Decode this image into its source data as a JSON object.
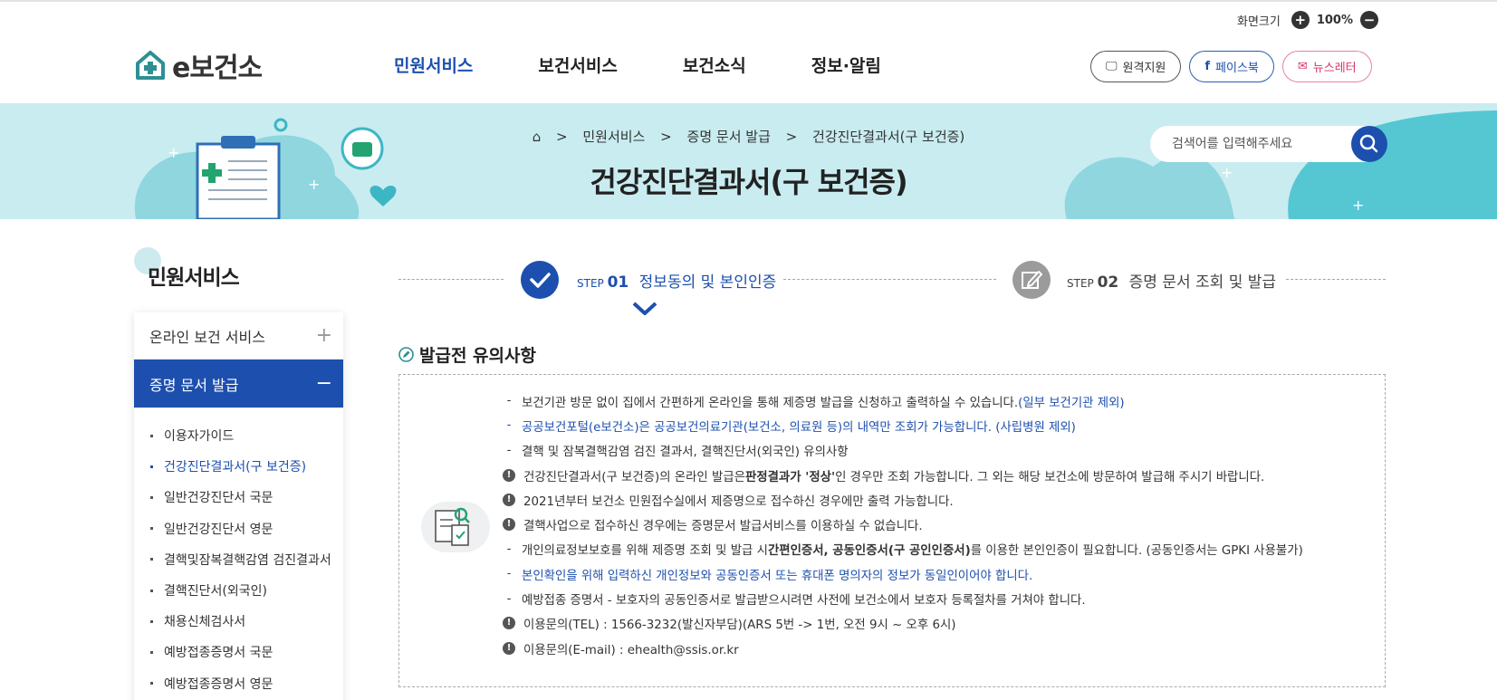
{
  "zoom": {
    "label": "화면크기",
    "value": "100%",
    "plus": "+",
    "minus": "−"
  },
  "logo": {
    "text": "e보건소"
  },
  "gnb": [
    {
      "label": "민원서비스",
      "active": true
    },
    {
      "label": "보건서비스"
    },
    {
      "label": "보건소식"
    },
    {
      "label": "정보·알림"
    }
  ],
  "header_buttons": {
    "remote": "원격지원",
    "facebook": "페이스북",
    "newsletter": "뉴스레터"
  },
  "breadcrumb": {
    "level1": "민원서비스",
    "level2": "증명 문서 발급",
    "level3": "건강진단결과서(구 보건증)",
    "sep": ">"
  },
  "page_title": "건강진단결과서(구 보건증)",
  "search": {
    "placeholder": "검색어를 입력해주세요"
  },
  "side": {
    "title": "민원서비스",
    "groups": [
      {
        "label": "온라인 보건 서비스",
        "toggle": "+"
      },
      {
        "label": "증명 문서 발급",
        "toggle": "−"
      }
    ],
    "items": [
      "이용자가이드",
      "건강진단결과서(구 보건증)",
      "일반건강진단서 국문",
      "일반건강진단서 영문",
      "결핵및잠복결핵감염 검진결과서",
      "결핵진단서(외국인)",
      "채용신체검사서",
      "예방접종증명서 국문",
      "예방접종증명서 영문"
    ]
  },
  "steps": [
    {
      "step": "STEP",
      "num": "01",
      "label": "정보동의 및 본인인증"
    },
    {
      "step": "STEP",
      "num": "02",
      "label": "증명 문서 조회 및 발급"
    }
  ],
  "notice": {
    "title": "발급전 유의사항",
    "dash": "-",
    "exc": "!",
    "line1": {
      "text": "보건기관 방문 없이 집에서 간편하게 온라인을 통해 제증명 발급을 신청하고 출력하실 수 있습니다.",
      "hl": "(일부 보건기관 제외)"
    },
    "line2": "공공보건포털(e보건소)은 공공보건의료기관(보건소, 의료원 등)의 내역만 조회가 가능합니다. (사립병원 제외)",
    "line3": "결핵 및 잠복결핵감염 검진 결과서, 결핵진단서(외국인) 유의사항",
    "line4": {
      "a": "건강진단결과서(구 보건증)의 온라인 발급은 ",
      "b": "판정결과가 '정상'",
      "c": "인 경우만 조회 가능합니다. 그 외는 해당 보건소에 방문하여 발급해 주시기 바랍니다."
    },
    "line5": "2021년부터 보건소 민원접수실에서 제증명으로 접수하신 경우에만 출력 가능합니다.",
    "line6": "결핵사업으로 접수하신 경우에는 증명문서 발급서비스를 이용하실 수 없습니다.",
    "line7": {
      "a": "개인의료정보보호를 위해 제증명 조회 및 발급 시 ",
      "b": "간편인증서, 공동인증서(구 공인인증서)",
      "c": "를 이용한 본인인증이 필요합니다. (공동인증서는 GPKI 사용불가)"
    },
    "line8": "본인확인을 위해 입력하신 개인정보와 공동인증서 또는 휴대폰 명의자의 정보가 동일인이어야 합니다.",
    "line9": "예방접종 증명서 - 보호자의 공동인증서로 발급받으시려면 사전에 보건소에서 보호자 등록절차를 거쳐야 합니다.",
    "line10": "이용문의(TEL) : 1566-3232(발신자부담)(ARS 5번 -> 1번, 오전 9시 ~ 오후 6시)",
    "line11": "이용문의(E-mail) : ehealth@ssis.or.kr"
  }
}
